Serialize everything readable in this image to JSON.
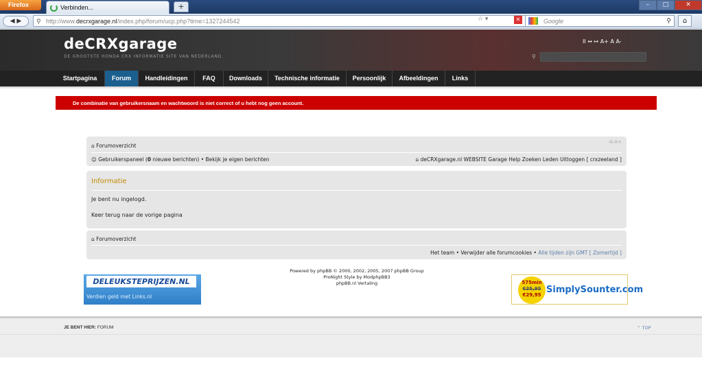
{
  "browser": {
    "app_button": "Firefox",
    "tab_title": "Verbinden...",
    "new_tab": "+",
    "url_domain": "decrxgarage.nl",
    "url_prefix": "http://www.",
    "url_suffix": "/index.php/forum/ucp.php?time=1327244542",
    "search_placeholder": "Google"
  },
  "site": {
    "logo": "deCRXgarage",
    "tagline": "DE GROOTSTE HONDA CRX INFORMATIE SITE VAN NEDERLAND.",
    "header_controls": "II ↔ ↦   A+ A A-"
  },
  "nav": [
    {
      "label": "Startpagina",
      "active": false
    },
    {
      "label": "Forum",
      "active": true
    },
    {
      "label": "Handleidingen",
      "active": false
    },
    {
      "label": "FAQ",
      "active": false
    },
    {
      "label": "Downloads",
      "active": false
    },
    {
      "label": "Technische informatie",
      "active": false
    },
    {
      "label": "Persoonlijk",
      "active": false
    },
    {
      "label": "Afbeeldingen",
      "active": false
    },
    {
      "label": "Links",
      "active": false
    }
  ],
  "alert": "De combinatie van gebruikersnaam en wachtwoord is niet correct of u hebt nog geen account.",
  "forum": {
    "index_label": "Forumoverzicht",
    "font_controls": "-A-A+",
    "ucp_prefix": "Gebruikerspaneel (",
    "new_count": "0",
    "ucp_suffix": " nieuwe berichten) • Bekijk je eigen berichten",
    "top_links": "deCRXgarage.nl WEBSITE  Garage  Help  Zoeken  Leden  Uitloggen [ crxzeeland ]",
    "info_title": "Informatie",
    "info_msg1": "Je bent nu ingelogd.",
    "info_msg2": "Keer terug naar de vorige pagina",
    "footer_links": "Het team • Verwijder alle forumcookies • ",
    "gmt": "Alle tijden zijn GMT [ Zomertijd ]"
  },
  "credits": {
    "line1": "Powered by phpBB © 2000, 2002, 2005, 2007 phpBB Group",
    "line2": "ProNight Style by ModphpBB3",
    "line3": "phpBB.nl Vertaling"
  },
  "ads": {
    "left_title": "DELEUKSTEPRIJZEN.NL",
    "left_sub": "Verdien geld met Links.nl",
    "right_badge_top": "575min",
    "right_badge_old": "€35,95",
    "right_badge_price": "€29,95",
    "right_brand": "SimplySounter.com"
  },
  "bottom": {
    "you_are_here": "JE BENT HIER:",
    "location": "FORUM",
    "top_link": "TOP"
  }
}
